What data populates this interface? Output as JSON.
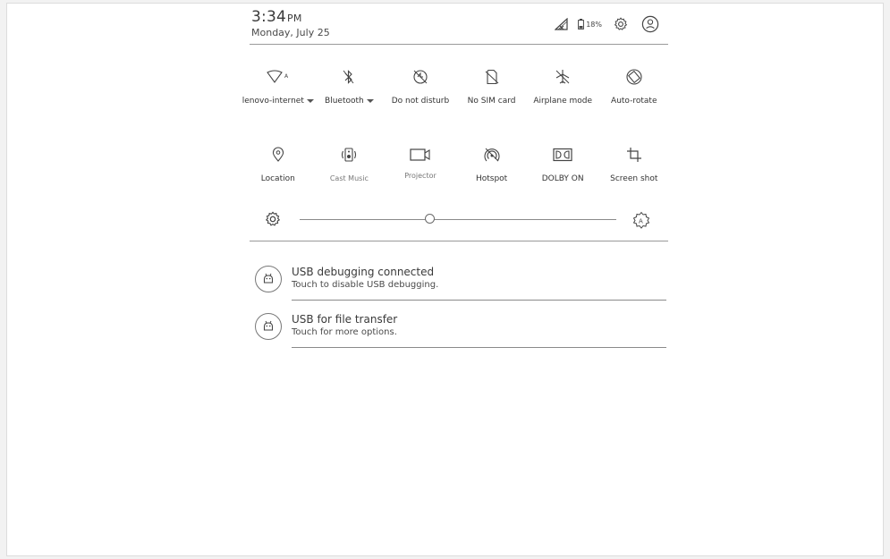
{
  "status": {
    "time": "3:34",
    "ampm": "PM",
    "date": "Monday, July 25",
    "battery": "18%"
  },
  "toggles_row1": [
    {
      "label": "lenovo-internet",
      "icon": "wifi-icon",
      "dropdown": true
    },
    {
      "label": "Bluetooth",
      "icon": "bluetooth-icon",
      "dropdown": true
    },
    {
      "label": "Do not disturb",
      "icon": "do-not-disturb-icon",
      "dropdown": false
    },
    {
      "label": "No SIM card",
      "icon": "no-sim-icon",
      "dropdown": false
    },
    {
      "label": "Airplane mode",
      "icon": "airplane-icon",
      "dropdown": false
    },
    {
      "label": "Auto-rotate",
      "icon": "auto-rotate-icon",
      "dropdown": false
    }
  ],
  "toggles_row2": [
    {
      "label": "Location",
      "icon": "location-icon"
    },
    {
      "label": "Cast  Music",
      "icon": "cast-music-icon"
    },
    {
      "label": "Projector",
      "icon": "projector-icon"
    },
    {
      "label": "Hotspot",
      "icon": "hotspot-icon"
    },
    {
      "label": "DOLBY ON",
      "icon": "dolby-icon"
    },
    {
      "label": "Screen shot",
      "icon": "screenshot-icon"
    }
  ],
  "brightness": {
    "level": 0.41
  },
  "notifications": [
    {
      "title": "USB debugging connected",
      "text": "Touch to disable USB debugging."
    },
    {
      "title": "USB for file transfer",
      "text": "Touch for more options."
    }
  ],
  "colors": {
    "background": "#ffffff",
    "line": "#8a8a8a",
    "text": "#3a3a3a"
  }
}
